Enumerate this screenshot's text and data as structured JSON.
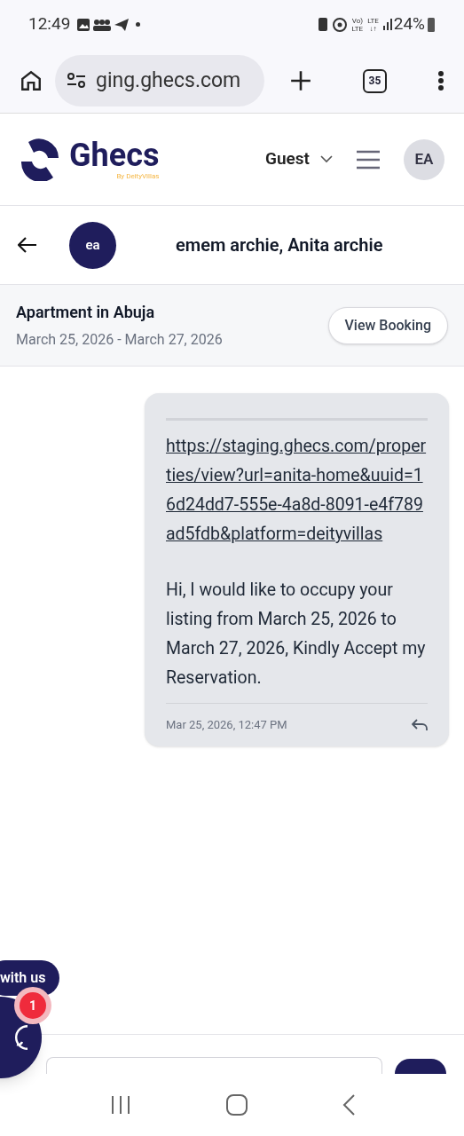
{
  "status_bar": {
    "time": "12:49",
    "volte_top": "Vo)",
    "volte_bottom": "LTE",
    "lte": "LTE",
    "lte_arrows": "↓↑",
    "battery": "24%"
  },
  "browser": {
    "url": "ging.ghecs.com",
    "tab_count": "35"
  },
  "header": {
    "logo": "Ghecs",
    "logo_tagline": "By DeityVillas",
    "role": "Guest",
    "avatar": "EA"
  },
  "chat_header": {
    "avatar": "ea",
    "title": "emem archie, Anita archie"
  },
  "booking": {
    "title": "Apartment in Abuja",
    "dates": "March 25, 2026 - March 27, 2026",
    "button": "View Booking"
  },
  "messages": [
    {
      "link": "https://staging.ghecs.com/properties/view?url=anita-home&uuid=16d24dd7-555e-4a8d-8091-e4f789ad5fdb&platform=deityvillas",
      "text": "Hi, I would like to occupy your listing from March 25, 2026 to March 27, 2026, Kindly Accept my Reservation.",
      "time": "Mar 25, 2026, 12:47 PM"
    }
  ],
  "chat_widget": {
    "label": "with us",
    "badge": "1"
  }
}
